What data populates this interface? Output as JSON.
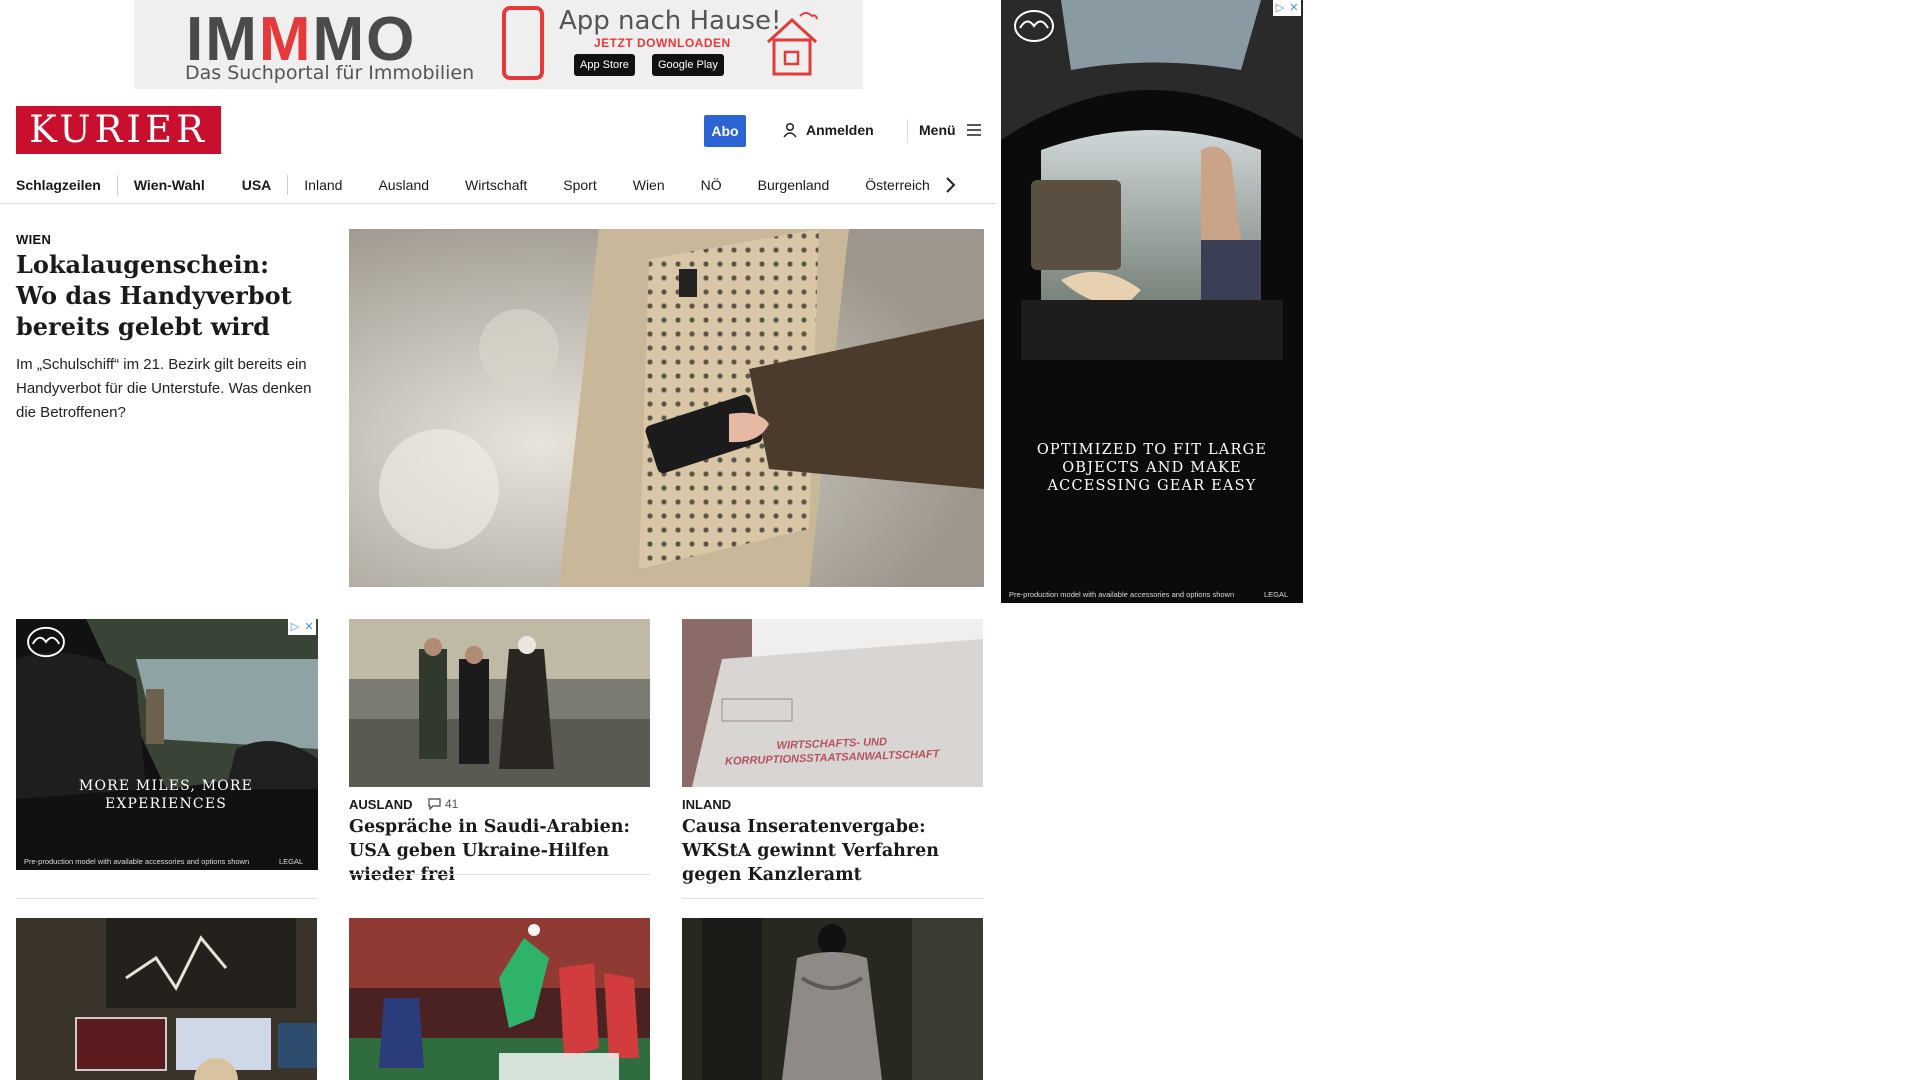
{
  "top_ad": {
    "logo_part1": "IM",
    "logo_part2": "M",
    "logo_part3": "MO",
    "tagline": "Das Suchportal für Immobilien",
    "headline": "App nach Hause!",
    "cta": "JETZT DOWNLOADEN",
    "app_store": "App Store",
    "google_play": "Google Play"
  },
  "header": {
    "logo": "KURIER",
    "abo": "Abo",
    "login": "Anmelden",
    "menu": "Menü"
  },
  "nav": {
    "items": [
      "Schlagzeilen",
      "Wien-Wahl",
      "USA",
      "Inland",
      "Ausland",
      "Wirtschaft",
      "Sport",
      "Wien",
      "NÖ",
      "Burgenland",
      "Österreich"
    ]
  },
  "lead": {
    "kicker": "WIEN",
    "title": "Lokalaugenschein: Wo das Handyverbot bereits gelebt wird",
    "teaser": "Im „Schulschiff“ im 21. Bezirk gilt bereits ein Handyverbot für die Unterstufe. Was denken die Betroffenen?"
  },
  "cards": [
    {
      "kicker": "AUSLAND",
      "comments": "41",
      "title": "Gespräche in Saudi-Arabien: USA geben Ukraine-Hilfen wieder frei"
    },
    {
      "kicker": "INLAND",
      "title": "Causa Inseratenvergabe: WKStA gewinnt Verfahren gegen Kanzleramt",
      "image_text": "WIRTSCHAFTS- UND KORRUPTIONSSTAATSANWALTSCHAFT"
    }
  ],
  "side_ad": {
    "brand": "mazda",
    "copy": "OPTIMIZED TO FIT LARGE OBJECTS AND MAKE ACCESSING GEAR EASY",
    "disclaimer": "Pre-production model with available accessories and options shown",
    "legal": "LEGAL"
  },
  "inline_ad": {
    "brand": "mazda",
    "copy": "MORE MILES, MORE EXPERIENCES",
    "disclaimer": "Pre-production model with available accessories and options shown",
    "legal": "LEGAL"
  },
  "colors": {
    "brand_red": "#c8102e",
    "abo_blue": "#2d64d3"
  }
}
